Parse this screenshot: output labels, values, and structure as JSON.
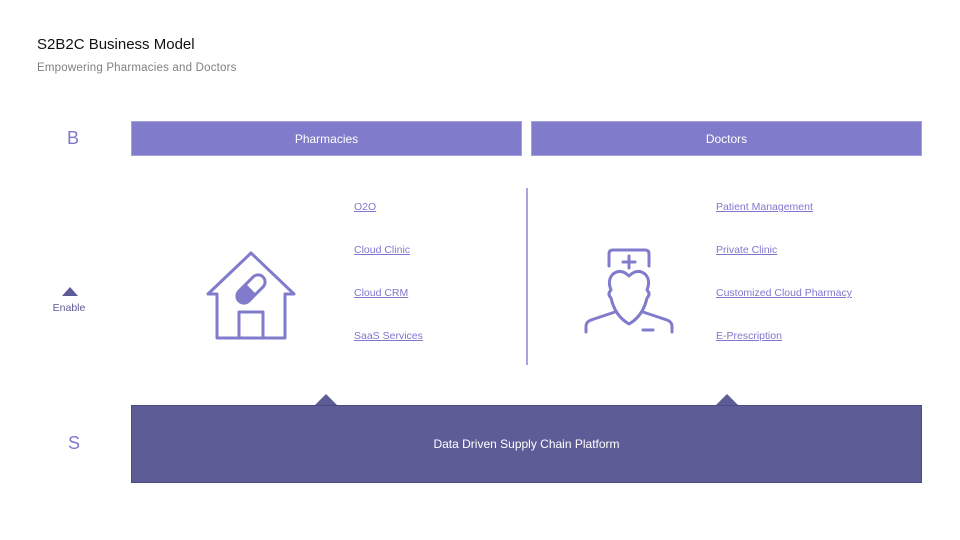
{
  "header": {
    "title": "S2B2C Business Model",
    "subtitle": "Empowering Pharmacies and Doctors"
  },
  "rows": {
    "b_label": "B",
    "s_label": "S",
    "enable_label": "Enable"
  },
  "columns": [
    {
      "label": "Pharmacies",
      "icon": "house-pill-icon",
      "links": [
        "O2O",
        "Cloud Clinic",
        "Cloud CRM",
        "SaaS Services"
      ]
    },
    {
      "label": "Doctors",
      "icon": "doctor-icon",
      "links": [
        "Patient Management",
        "Private Clinic",
        "Customized Cloud Pharmacy",
        "E-Prescription"
      ]
    }
  ],
  "platform": {
    "label": "Data Driven Supply Chain Platform"
  },
  "colors": {
    "accent": "#817bcc",
    "platform": "#5e5c96",
    "link": "#7f78cc"
  }
}
